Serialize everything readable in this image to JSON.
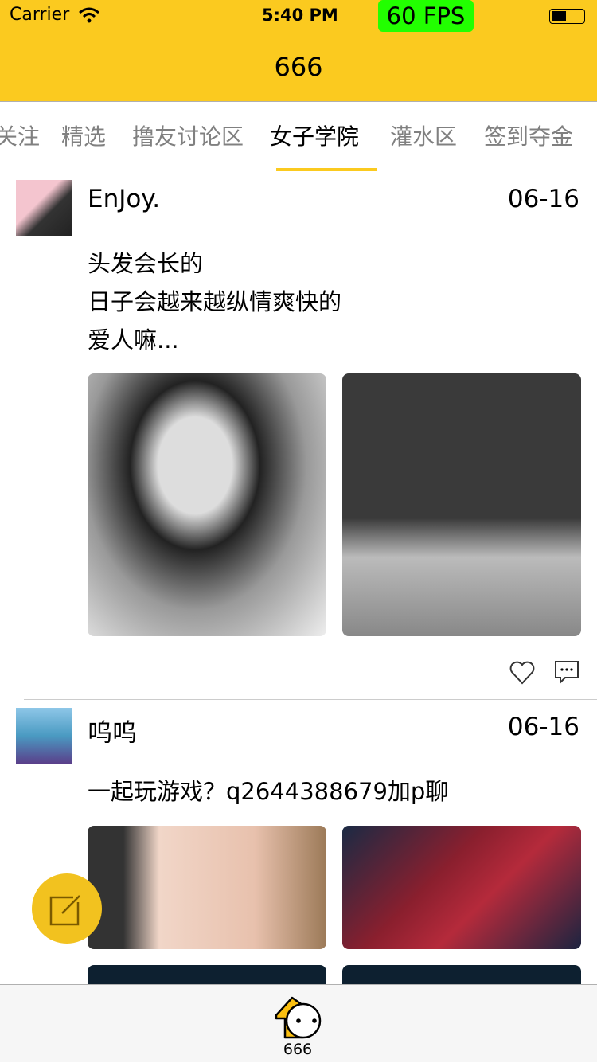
{
  "status_bar": {
    "carrier": "Carrier",
    "time": "5:40 PM",
    "fps": "60 FPS",
    "fps_color": "#22FF00"
  },
  "nav": {
    "title": "666",
    "color": "#FBCA1F"
  },
  "tabs": [
    {
      "label": "关注"
    },
    {
      "label": "精选"
    },
    {
      "label": "撸友讨论区"
    },
    {
      "label": "女子学院",
      "active": true
    },
    {
      "label": "灌水区"
    },
    {
      "label": "签到夺金"
    }
  ],
  "posts": [
    {
      "name": "EnJoy.",
      "date": "06-16",
      "lines": [
        "头发会长的",
        "日子会越来越纵情爽快的",
        "爱人嘛..."
      ]
    },
    {
      "name": "呜呜",
      "date": "06-16",
      "lines": [
        "一起玩游戏？q2644388679加p聊"
      ]
    }
  ],
  "tabbar": {
    "label": "666"
  }
}
